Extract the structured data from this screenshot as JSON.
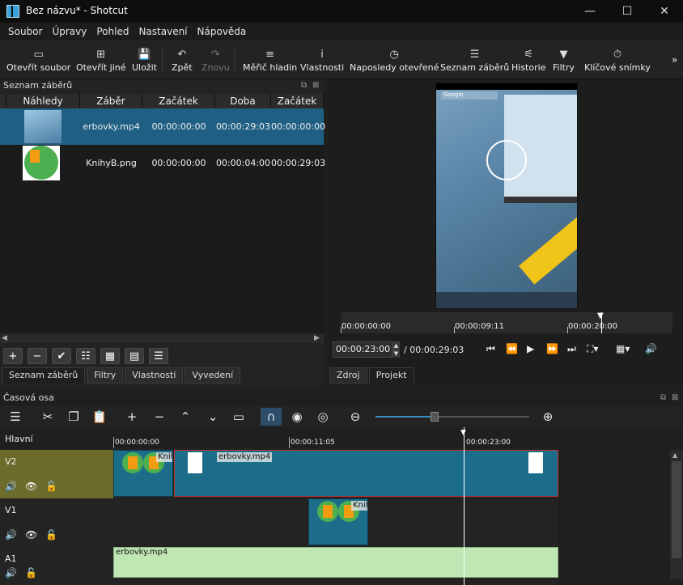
{
  "window": {
    "title": "Bez názvu* - Shotcut",
    "min": "—",
    "max": "☐",
    "close": "✕"
  },
  "menu": [
    "Soubor",
    "Úpravy",
    "Pohled",
    "Nastavení",
    "Nápověda"
  ],
  "toolbar": [
    {
      "label": "Otevřít soubor",
      "icon": "open-file-icon",
      "glyph": "▭"
    },
    {
      "label": "Otevřít jiné",
      "icon": "open-other-icon",
      "glyph": "⊞"
    },
    {
      "label": "Uložit",
      "icon": "save-icon",
      "glyph": "💾"
    },
    {
      "label": "Zpět",
      "icon": "undo-icon",
      "glyph": "↶"
    },
    {
      "label": "Znovu",
      "icon": "redo-icon",
      "glyph": "↷",
      "disabled": true
    },
    {
      "label": "Měřič hladin",
      "icon": "audio-meter-icon",
      "glyph": "≡"
    },
    {
      "label": "Vlastnosti",
      "icon": "info-icon",
      "glyph": "i"
    },
    {
      "label": "Naposledy otevřené",
      "icon": "clock-icon",
      "glyph": "◷"
    },
    {
      "label": "Seznam záběrů",
      "icon": "list-icon",
      "glyph": "☰"
    },
    {
      "label": "Historie",
      "icon": "history-icon",
      "glyph": "⚟"
    },
    {
      "label": "Filtry",
      "icon": "filter-icon",
      "glyph": "▼"
    },
    {
      "label": "Klíčové snímky",
      "icon": "stopwatch-icon",
      "glyph": "⏱"
    }
  ],
  "playlist": {
    "title": "Seznam záběrů",
    "columns": [
      "Náhledy",
      "Záběr",
      "Začátek záběru",
      "Doba trvání",
      "Začátek"
    ],
    "rows": [
      {
        "clip": "erbovky.mp4",
        "in": "00:00:00:00",
        "duration": "00:00:29:03",
        "start": "00:00:00:00",
        "selected": true
      },
      {
        "clip": "KnihyB.png",
        "in": "00:00:00:00",
        "duration": "00:00:04:00",
        "start": "00:00:29:03",
        "selected": false
      }
    ],
    "tabs": [
      "Seznam záběrů",
      "Filtry",
      "Vlastnosti",
      "Vyvedení"
    ]
  },
  "player": {
    "ruler": [
      "00:00:00:00",
      "00:00:09:11",
      "00:00:20:00"
    ],
    "timecode": "00:00:23:00",
    "total": "/ 00:00:29:03",
    "tabs": [
      "Zdroj",
      "Projekt"
    ],
    "phone_search": "Google"
  },
  "timeline": {
    "title": "Časová osa",
    "master": "Hlavní",
    "ruler": [
      "00:00:00:00",
      "00:00:11:05",
      "00:00:23:00"
    ],
    "tracks": [
      {
        "name": "V2"
      },
      {
        "name": "V1"
      },
      {
        "name": "A1"
      }
    ],
    "clips": {
      "v2_small": "Knih",
      "v2_main": "erbovky.mp4",
      "v1": "Knih",
      "a1": "erbovky.mp4"
    }
  },
  "colors": {
    "selection": "#1f5f83",
    "v2_header": "#6b6b2c",
    "audio_clip": "#bfe6b3",
    "clip_teal": "#1b6d8a"
  }
}
